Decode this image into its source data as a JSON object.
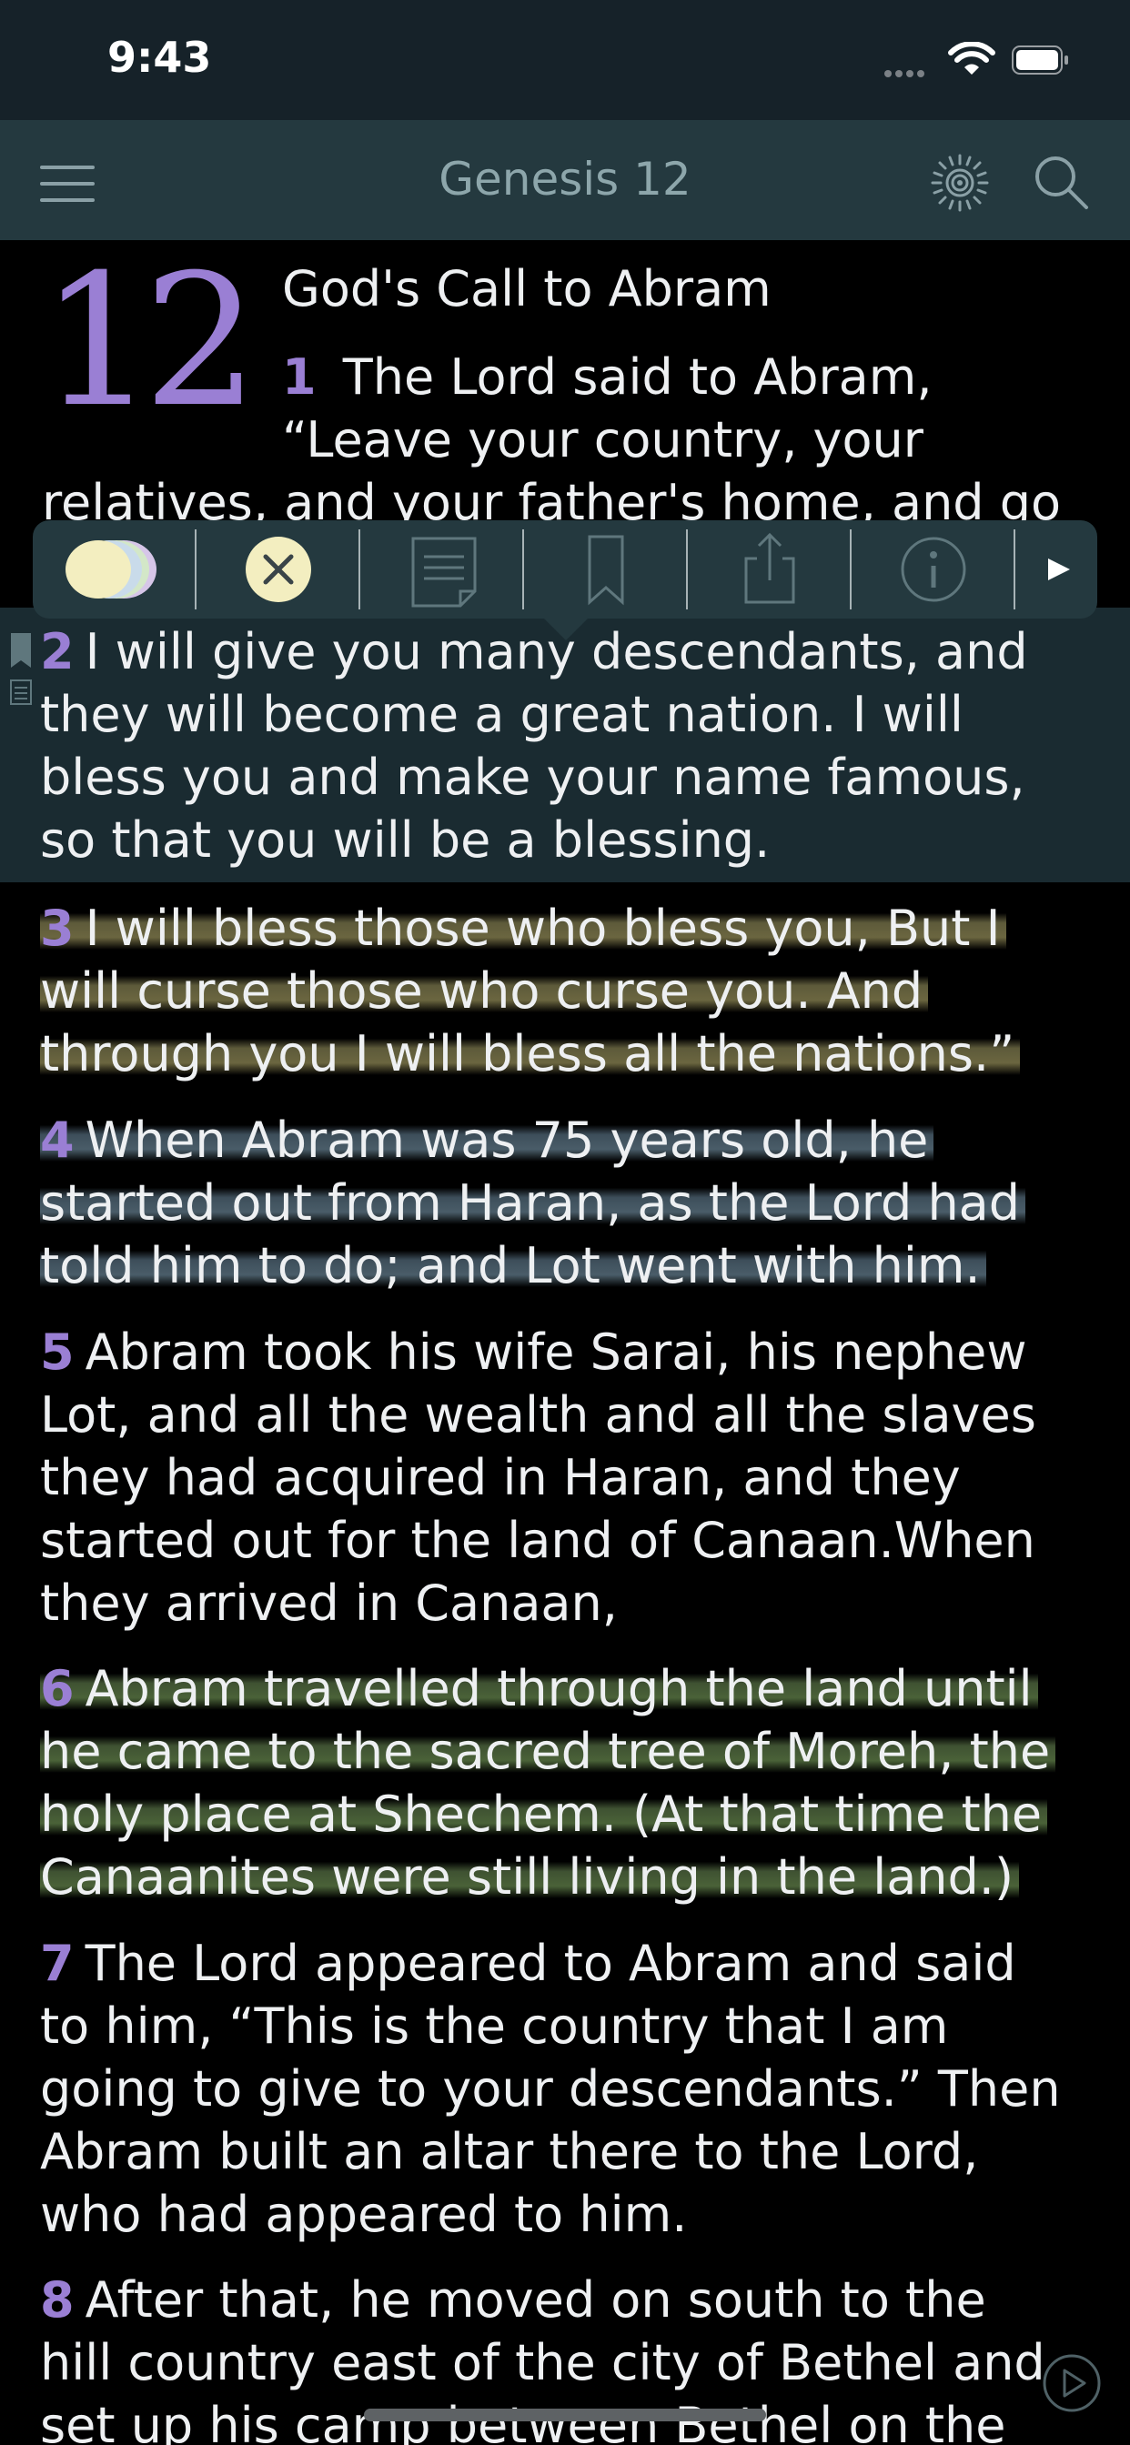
{
  "status": {
    "time": "9:43"
  },
  "nav": {
    "title": "Genesis 12"
  },
  "chapter": {
    "number": "12",
    "heading": "God's Call to Abram"
  },
  "verses": [
    {
      "num": "1",
      "lines": [
        "The Lord said to Abram,",
        "“Leave your country, your",
        "relatives, and your father's home, and go"
      ]
    },
    {
      "num": "2",
      "lines": [
        "I will give you many descendants, and",
        "they will become a great nation. I will",
        "bless you and make your name famous,",
        "so that you will be a blessing."
      ]
    },
    {
      "num": "3",
      "lines": [
        "I will bless those who bless you, But I",
        "will curse those who curse you. And",
        "through you I will bless all the nations.”"
      ],
      "highlight": "yellow"
    },
    {
      "num": "4",
      "lines": [
        "When Abram was 75 years old, he",
        "started out from Haran, as the Lord had",
        "told him to do; and Lot went with him."
      ],
      "highlight": "blue"
    },
    {
      "num": "5",
      "lines": [
        "Abram took his wife Sarai, his nephew",
        "Lot, and all the wealth and all the slaves",
        "they had acquired in Haran, and they",
        "started out for the land of Canaan.When",
        "they arrived in Canaan,"
      ]
    },
    {
      "num": "6",
      "lines": [
        "Abram travelled through the land until",
        "he came to the sacred tree of Moreh, the",
        "holy place at Shechem. (At that time the",
        "Canaanites were still living in the land.)"
      ],
      "highlight": "green"
    },
    {
      "num": "7",
      "lines": [
        "The Lord appeared to Abram and said",
        "to him, “This is the country that I am",
        "going to give to your descendants.” Then",
        "Abram built an altar there to the Lord,",
        "who had appeared to him."
      ]
    },
    {
      "num": "8",
      "lines": [
        "After that, he moved on south to the",
        "hill country east of the city of Bethel and",
        "set up his camp between Bethel on the"
      ]
    }
  ],
  "toolbar": {
    "items": [
      "highlight-colors-icon",
      "clear-highlight-icon",
      "note-icon",
      "bookmark-icon",
      "share-icon",
      "info-icon",
      "more-arrow-icon"
    ]
  },
  "colors": {
    "accent": "#9a7fd4",
    "navbar": "#24393f",
    "highlight_yellow": "#6b6640",
    "highlight_blue": "#4a5d69",
    "highlight_green": "#4a6238"
  }
}
